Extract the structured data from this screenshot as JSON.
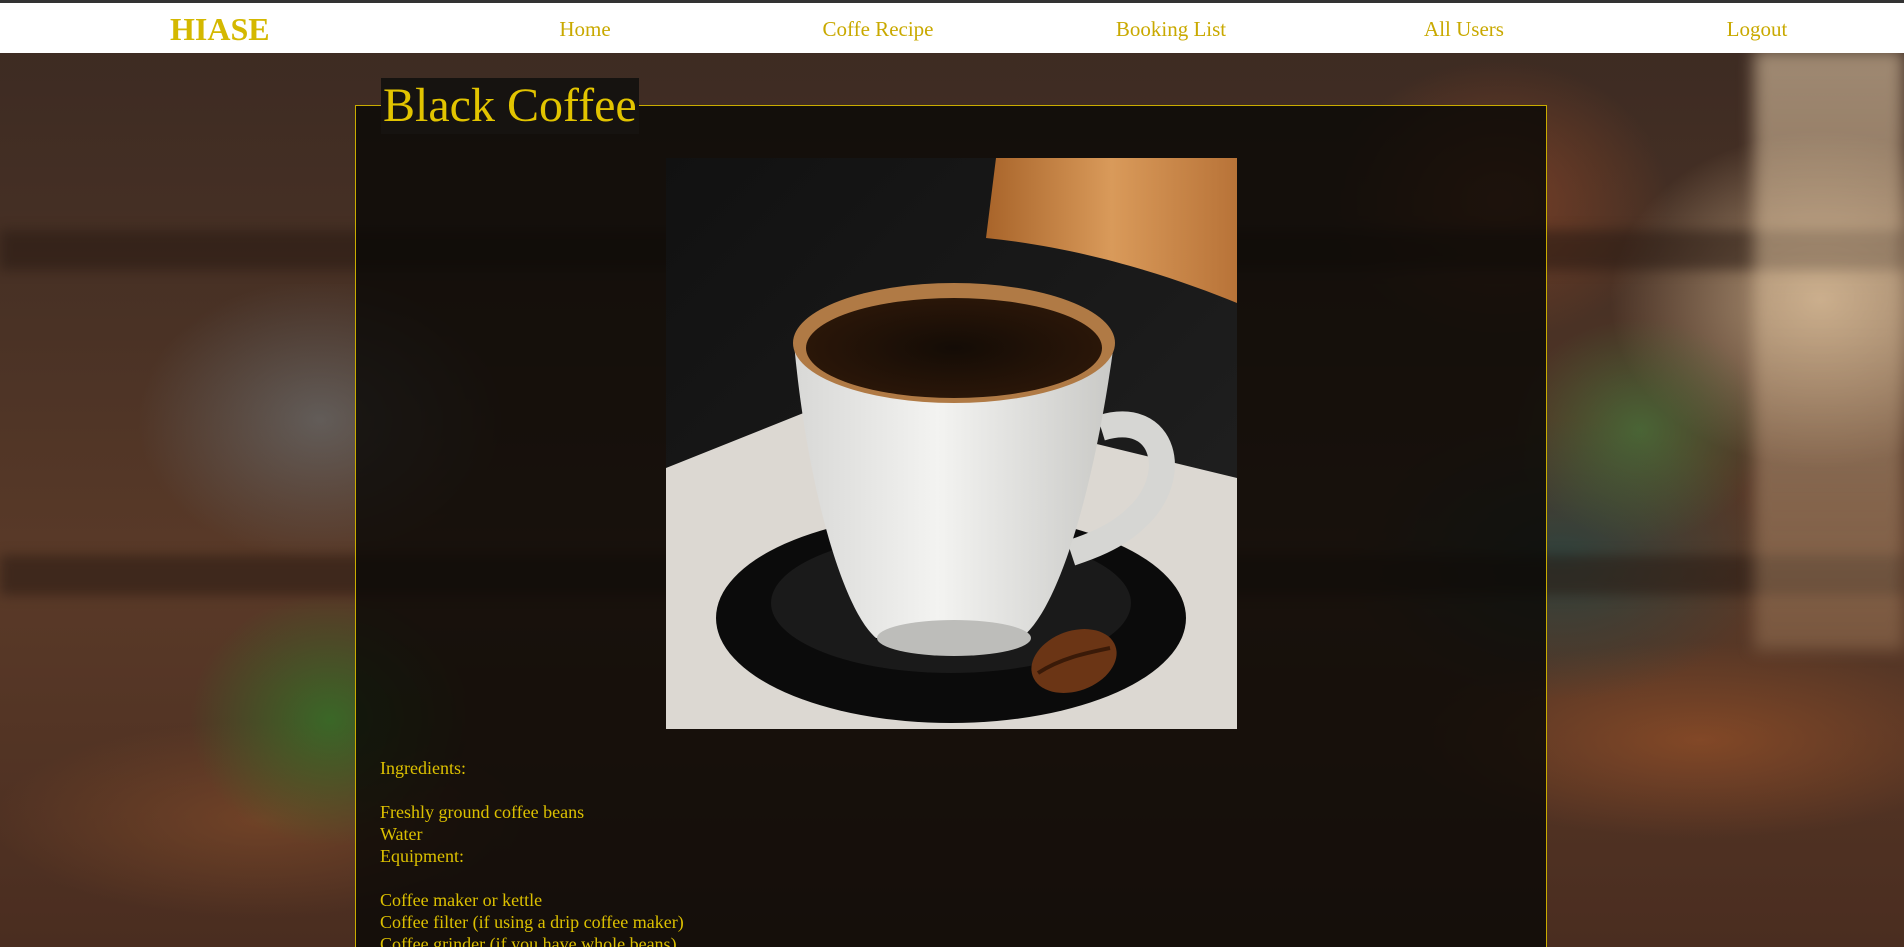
{
  "navbar": {
    "brand": "HIASE",
    "links": [
      {
        "label": "Home"
      },
      {
        "label": "Coffe Recipe"
      },
      {
        "label": "Booking List"
      },
      {
        "label": "All Users"
      },
      {
        "label": "Logout"
      }
    ]
  },
  "recipe": {
    "title": "Black Coffee",
    "image_alt_icon": "black-coffee-cup-photo",
    "ingredients_heading": "Ingredients:",
    "ingredients": [
      "Freshly ground coffee beans",
      "Water"
    ],
    "equipment_heading": "Equipment:",
    "equipment": [
      "Coffee maker or kettle",
      "Coffee filter (if using a drip coffee maker)",
      "Coffee grinder (if you have whole beans)"
    ]
  },
  "colors": {
    "accent": "#d4b800",
    "panel_border": "#c9ac00",
    "navbar_bg": "#ffffff"
  }
}
